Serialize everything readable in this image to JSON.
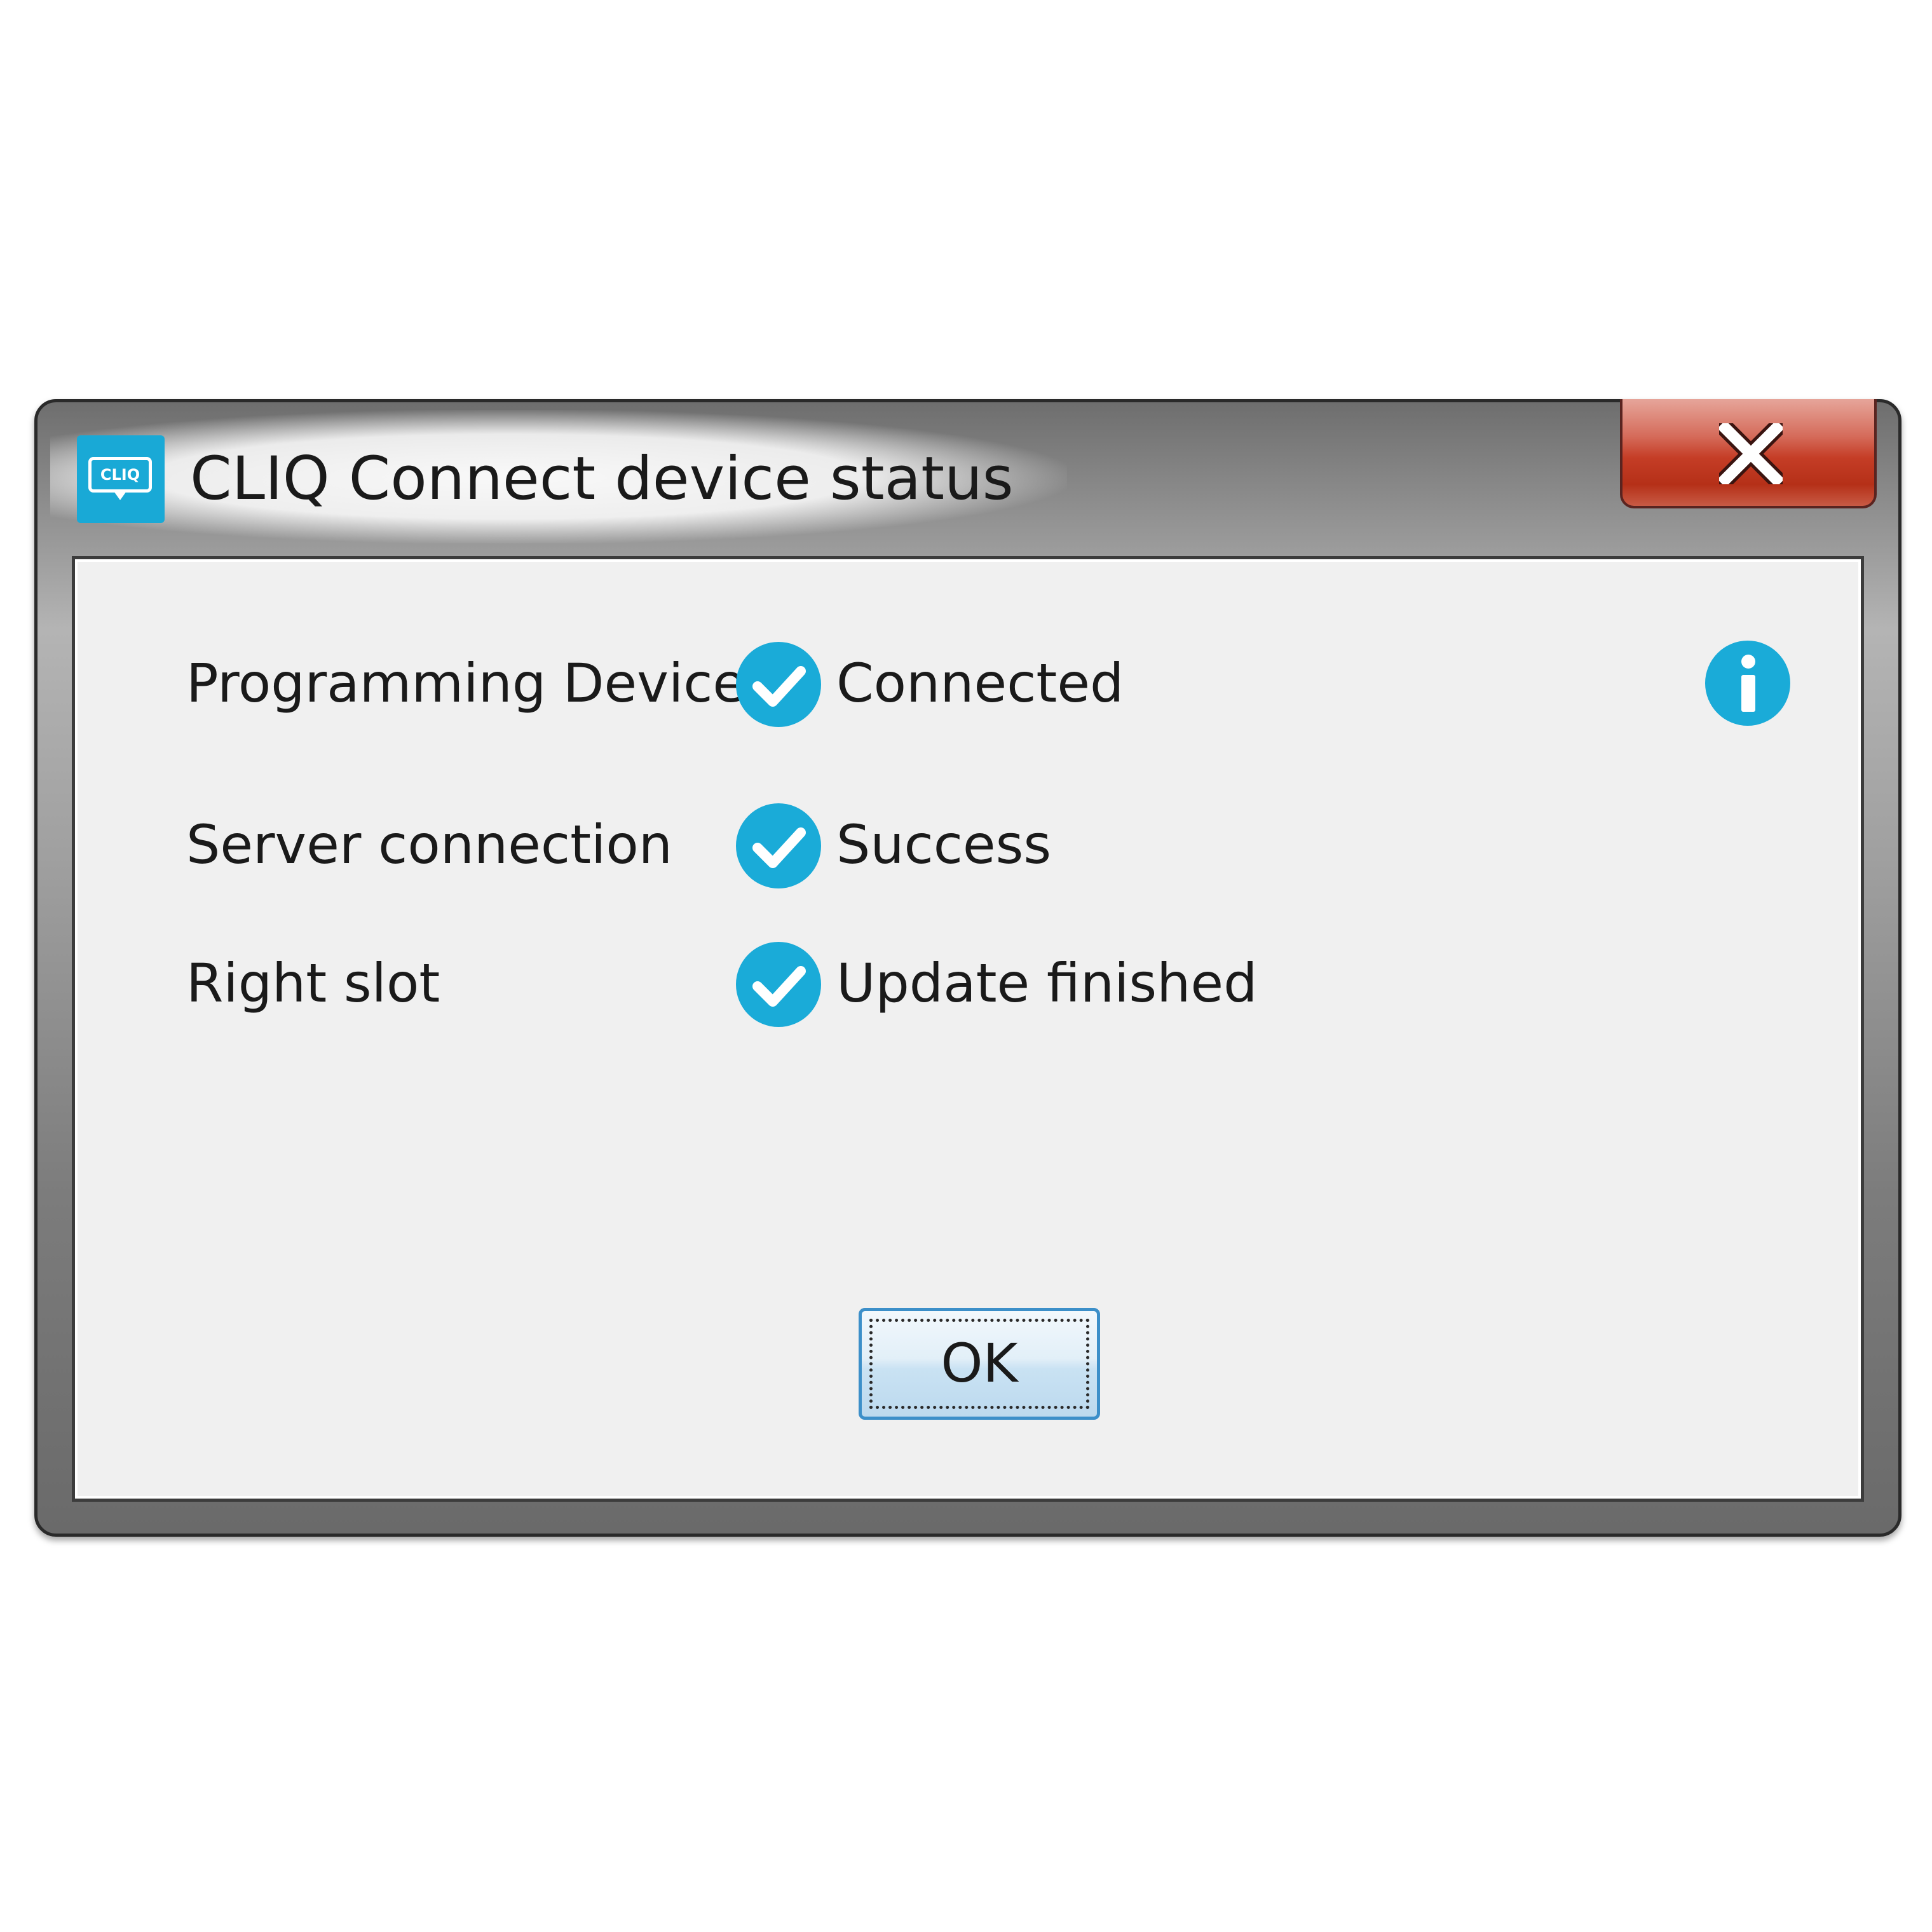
{
  "window": {
    "title": "CLIQ Connect device status",
    "icon_text": "CLIQ",
    "close_icon": "close-icon"
  },
  "status_rows": [
    {
      "label": "Programming Device",
      "value": "Connected",
      "icon": "check-circle-icon"
    },
    {
      "label": "Server connection",
      "value": "Success",
      "icon": "check-circle-icon"
    },
    {
      "label": "Right slot",
      "value": "Update finished",
      "icon": "check-circle-icon"
    }
  ],
  "info_icon": "info-icon",
  "buttons": {
    "ok_label": "OK"
  },
  "colors": {
    "accent": "#1aabd8",
    "close_button": "#c53d26",
    "client_background": "#f0f0f0"
  }
}
